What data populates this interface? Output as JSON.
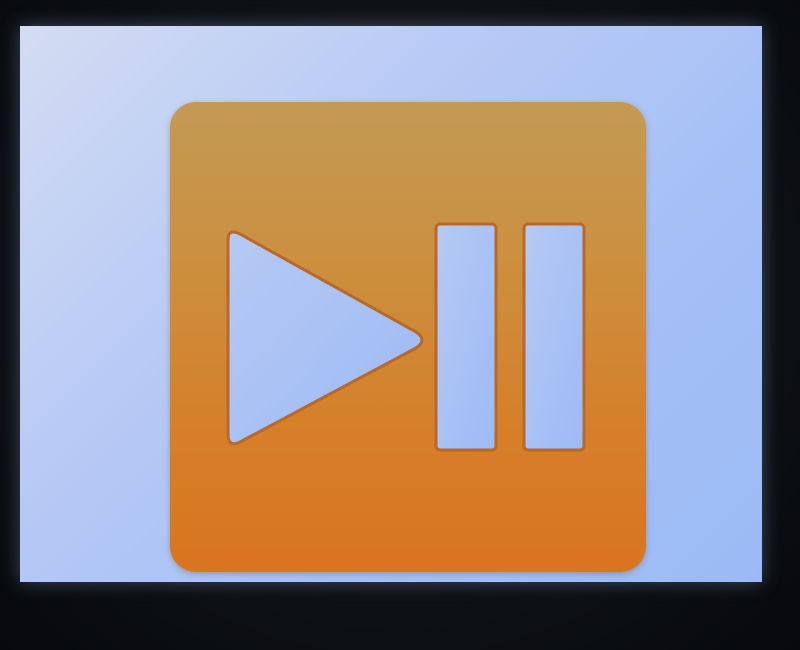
{
  "media_control": {
    "icon": "play-pause-icon",
    "tile_color": "#d9801f",
    "glyph_color": "#a9c3f5"
  }
}
